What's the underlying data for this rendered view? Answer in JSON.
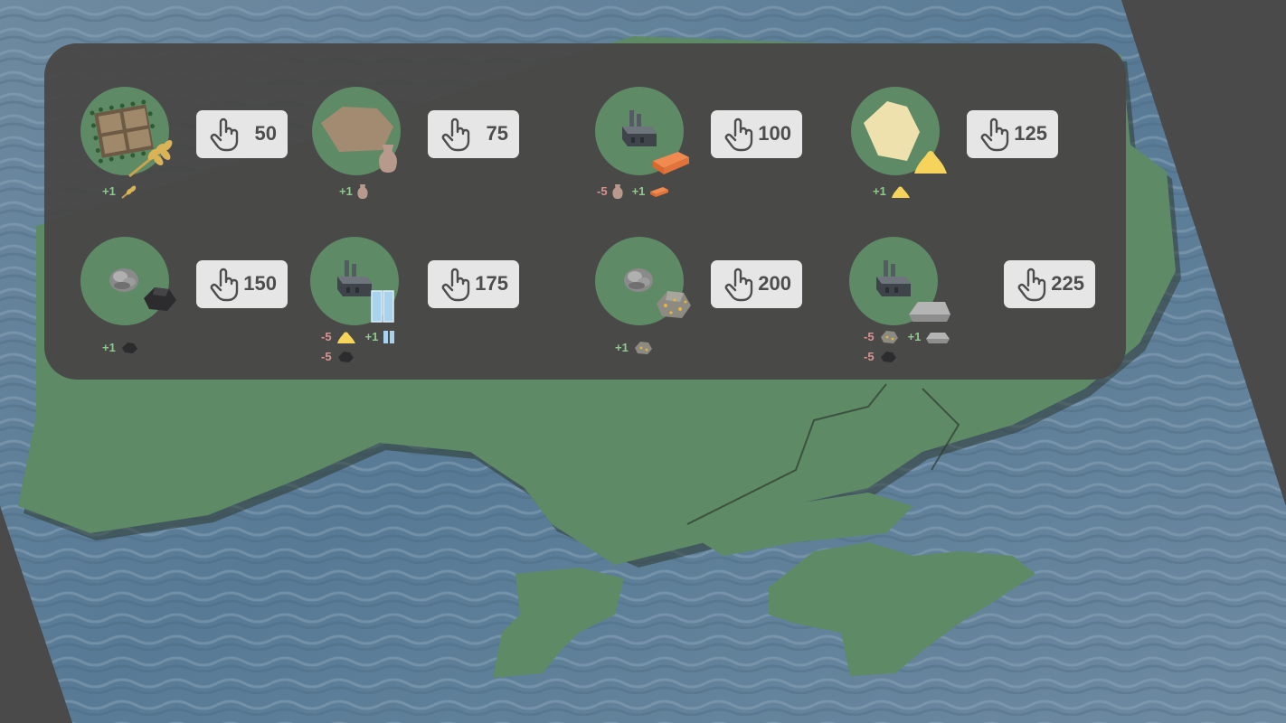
{
  "colors": {
    "panel": "#484846",
    "land": "#5e8a66",
    "water": "#5c7a92",
    "button": "#e6e6e6",
    "price_text": "#4d4d4d",
    "gain_text": "#8fc78f",
    "cost_text": "#d99292"
  },
  "buildings": [
    {
      "id": "farm",
      "building_icon": "wheat-field-icon",
      "output_icon": "wheat-icon",
      "price": "50",
      "effects": [
        {
          "sign": "+1",
          "icon": "wheat-icon"
        }
      ]
    },
    {
      "id": "clay-pit",
      "building_icon": "clay-pit-icon",
      "output_icon": "clay-vase-icon",
      "price": "75",
      "effects": [
        {
          "sign": "+1",
          "icon": "clay-vase-icon"
        }
      ]
    },
    {
      "id": "brick-factory",
      "building_icon": "factory-icon",
      "output_icon": "brick-icon",
      "price": "100",
      "effects": [
        {
          "sign": "-5",
          "icon": "clay-vase-icon"
        },
        {
          "sign": "+1",
          "icon": "brick-icon"
        }
      ]
    },
    {
      "id": "sand-quarry",
      "building_icon": "sand-pit-icon",
      "output_icon": "sand-pile-icon",
      "price": "125",
      "effects": [
        {
          "sign": "+1",
          "icon": "sand-pile-icon"
        }
      ]
    },
    {
      "id": "coal-mine",
      "building_icon": "mine-rock-icon",
      "output_icon": "coal-icon",
      "price": "150",
      "effects": [
        {
          "sign": "+1",
          "icon": "coal-icon"
        }
      ]
    },
    {
      "id": "glass-factory",
      "building_icon": "factory-icon",
      "output_icon": "glass-icon",
      "price": "175",
      "effects": [
        {
          "sign": "-5",
          "icon": "sand-pile-icon"
        },
        {
          "sign": "+1",
          "icon": "glass-icon"
        },
        {
          "sign": "-5",
          "icon": "coal-icon"
        }
      ]
    },
    {
      "id": "ore-mine",
      "building_icon": "mine-rock-icon",
      "output_icon": "ore-icon",
      "price": "200",
      "effects": [
        {
          "sign": "+1",
          "icon": "ore-icon"
        }
      ]
    },
    {
      "id": "steel-factory",
      "building_icon": "factory-icon",
      "output_icon": "steel-ingot-icon",
      "price": "225",
      "effects": [
        {
          "sign": "-5",
          "icon": "ore-icon"
        },
        {
          "sign": "+1",
          "icon": "steel-ingot-icon"
        },
        {
          "sign": "-5",
          "icon": "coal-icon"
        }
      ]
    }
  ]
}
